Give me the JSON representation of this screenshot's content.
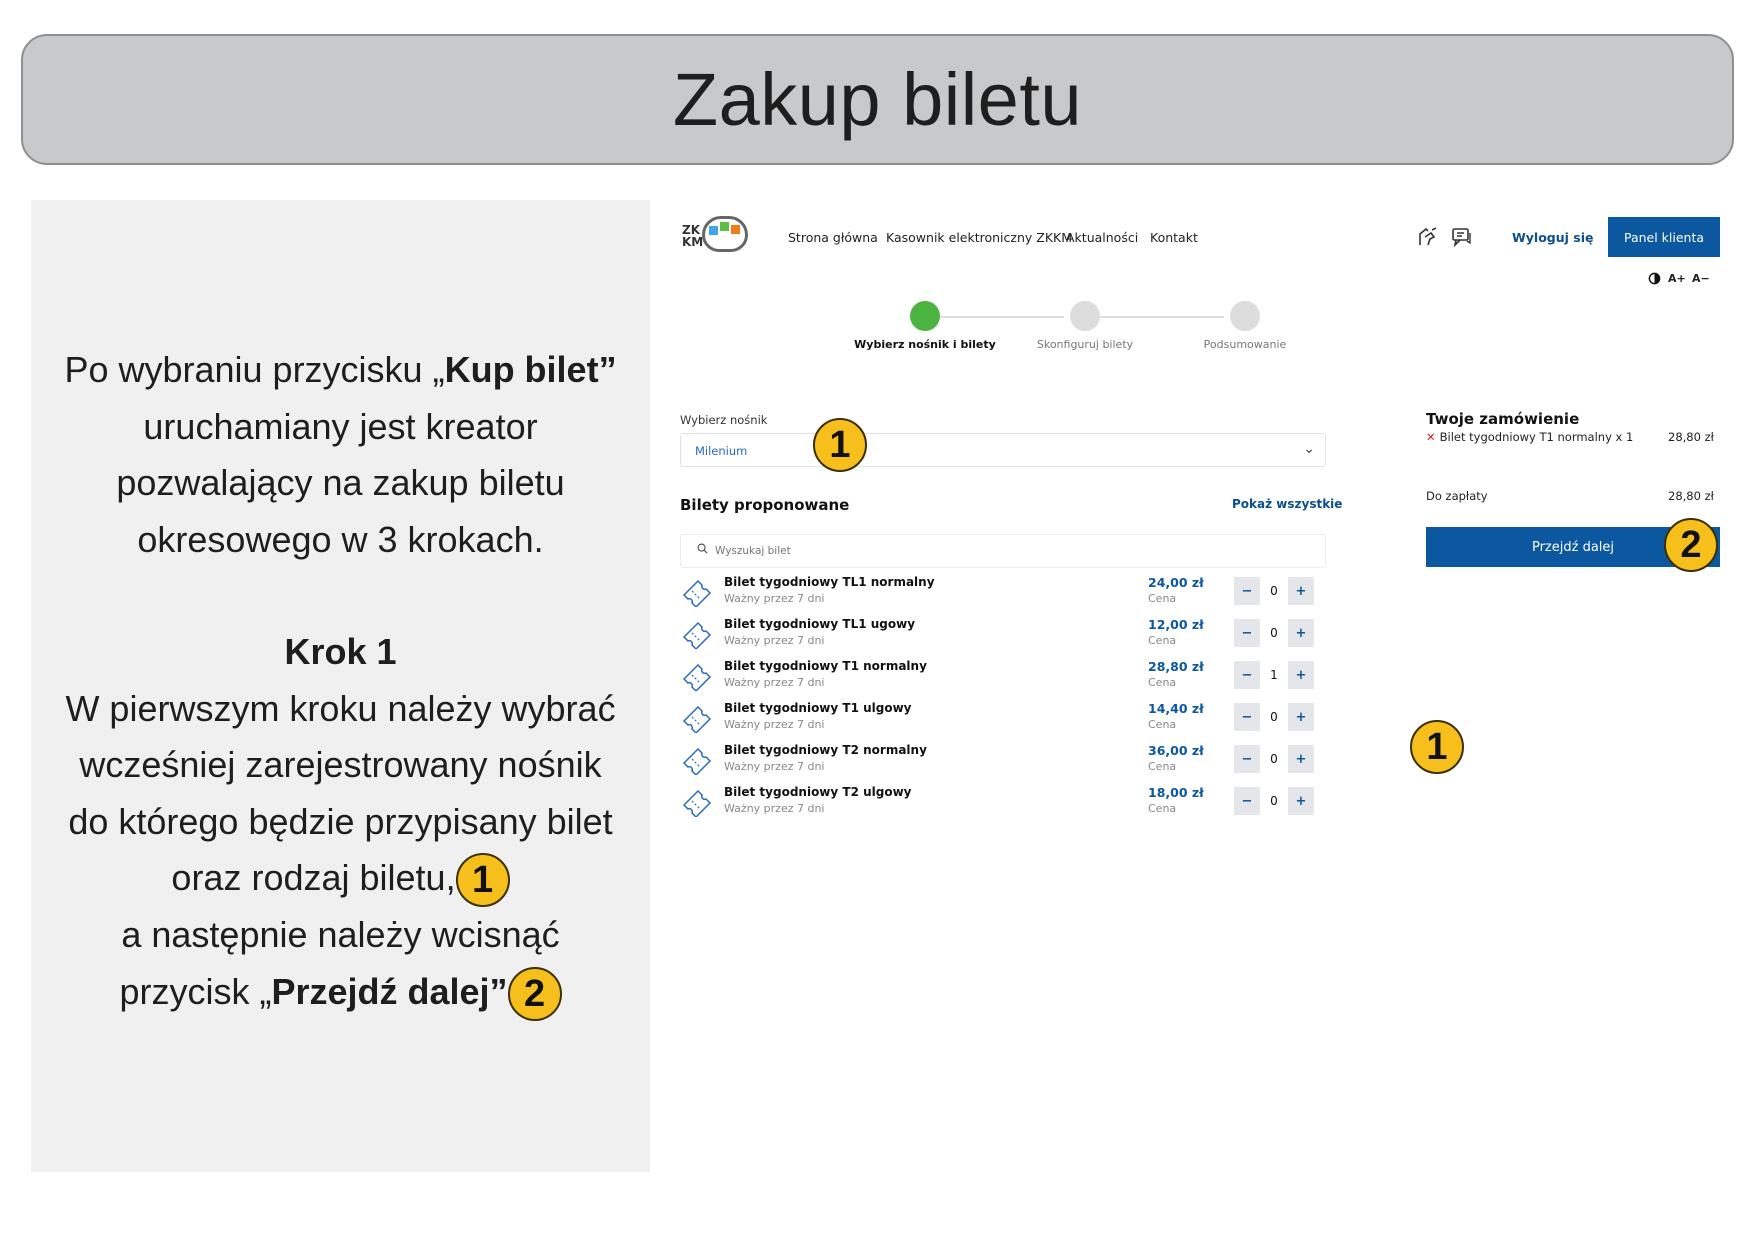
{
  "slide": {
    "title": "Zakup biletu"
  },
  "instructions": {
    "p1_a": "Po wybraniu przycisku „",
    "p1_b": "Kup bilet”",
    "p1_c": "uruchamiany jest  kreator",
    "p1_d": "pozwalający na zakup biletu",
    "p1_e": "okresowego w 3 krokach.",
    "step_heading": "Krok 1",
    "p2_a": "W pierwszym kroku należy wybrać",
    "p2_b": "wcześniej zarejestrowany nośnik",
    "p2_c": "do którego będzie przypisany bilet",
    "p2_d": "oraz rodzaj biletu,",
    "p2_e": "a następnie należy wcisnąć",
    "p2_f": "przycisk „",
    "p2_g": "Przejdź dalej”",
    "badge1": "1",
    "badge2": "2"
  },
  "header": {
    "logo_text_top": "ZK",
    "logo_text_bottom": "KM",
    "nav": [
      "Strona główna",
      "Kasownik elektroniczny ZKKM",
      "Aktualności",
      "Kontakt"
    ],
    "logout": "Wyloguj się",
    "client_panel": "Panel klienta",
    "contrast_icon": "contrast-icon",
    "font_up": "A+",
    "font_down": "A−",
    "icon_accessibility": "accessibility-icon",
    "icon_messages": "chat-icon"
  },
  "wizard": {
    "steps": [
      "Wybierz nośnik i bilety",
      "Skonfiguruj bilety",
      "Podsumowanie"
    ],
    "active_step": 0,
    "active_color": "#4bb33f"
  },
  "carrier": {
    "label": "Wybierz nośnik",
    "value": "Milenium"
  },
  "tickets": {
    "title": "Bilety proponowane",
    "show_all": "Pokaż wszystkie",
    "search_placeholder": "Wyszukaj bilet",
    "items": [
      {
        "name": "Bilet tygodniowy TL1 normalny",
        "validity": "Ważny przez 7 dni",
        "price": "24,00 zł",
        "price_label": "Cena",
        "qty": "0"
      },
      {
        "name": "Bilet tygodniowy TL1 ugowy",
        "validity": "Ważny przez 7 dni",
        "price": "12,00 zł",
        "price_label": "Cena",
        "qty": "0"
      },
      {
        "name": "Bilet tygodniowy T1 normalny",
        "validity": "Ważny przez 7 dni",
        "price": "28,80 zł",
        "price_label": "Cena",
        "qty": "1"
      },
      {
        "name": "Bilet tygodniowy T1 ulgowy",
        "validity": "Ważny przez 7 dni",
        "price": "14,40 zł",
        "price_label": "Cena",
        "qty": "0"
      },
      {
        "name": "Bilet tygodniowy T2 normalny",
        "validity": "Ważny przez 7 dni",
        "price": "36,00 zł",
        "price_label": "Cena",
        "qty": "0"
      },
      {
        "name": "Bilet tygodniowy T2 ulgowy",
        "validity": "Ważny przez 7 dni",
        "price": "18,00 zł",
        "price_label": "Cena",
        "qty": "0"
      }
    ],
    "minus": "−",
    "plus": "+"
  },
  "order": {
    "title": "Twoje zamówienie",
    "item": "Bilet tygodniowy T1 normalny x 1",
    "item_price": "28,80 zł",
    "due_label": "Do zapłaty",
    "due_value": "28,80 zł",
    "proceed": "Przejdź dalej"
  },
  "colors": {
    "primary": "#0b57a0",
    "badge": "#f6bf1c",
    "remove": "#d82020"
  }
}
